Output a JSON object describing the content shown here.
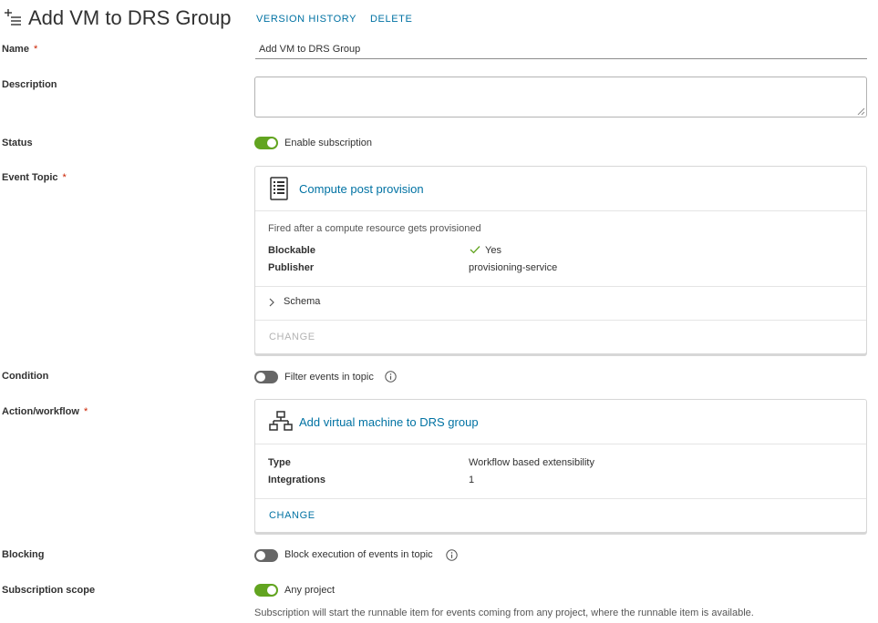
{
  "header": {
    "title": "Add VM to DRS Group",
    "version_history": "VERSION HISTORY",
    "delete": "DELETE"
  },
  "form": {
    "name": {
      "label": "Name",
      "value": "Add VM to DRS Group"
    },
    "description": {
      "label": "Description",
      "value": ""
    },
    "status": {
      "label": "Status",
      "toggle_label": "Enable subscription",
      "enabled": true
    },
    "event_topic": {
      "label": "Event Topic",
      "title": "Compute post provision",
      "description": "Fired after a compute resource gets provisioned",
      "blockable_key": "Blockable",
      "blockable_value": "Yes",
      "publisher_key": "Publisher",
      "publisher_value": "provisioning-service",
      "schema_label": "Schema",
      "change_label": "CHANGE"
    },
    "condition": {
      "label": "Condition",
      "toggle_label": "Filter events in topic",
      "enabled": false
    },
    "action_workflow": {
      "label": "Action/workflow",
      "title": "Add virtual machine  to DRS group",
      "type_key": "Type",
      "type_value": "Workflow based extensibility",
      "integrations_key": "Integrations",
      "integrations_value": "1",
      "change_label": "CHANGE"
    },
    "blocking": {
      "label": "Blocking",
      "toggle_label": "Block execution of events in topic",
      "enabled": false
    },
    "subscription_scope": {
      "label": "Subscription scope",
      "toggle_label": "Any project",
      "enabled": true,
      "note": "Subscription will start the runnable item for events coming from any project, where the runnable item is available."
    }
  },
  "required_marker": "*",
  "colors": {
    "link": "#0072a3",
    "toggle_on": "#62a420",
    "toggle_off": "#666666",
    "required": "#c92100"
  }
}
